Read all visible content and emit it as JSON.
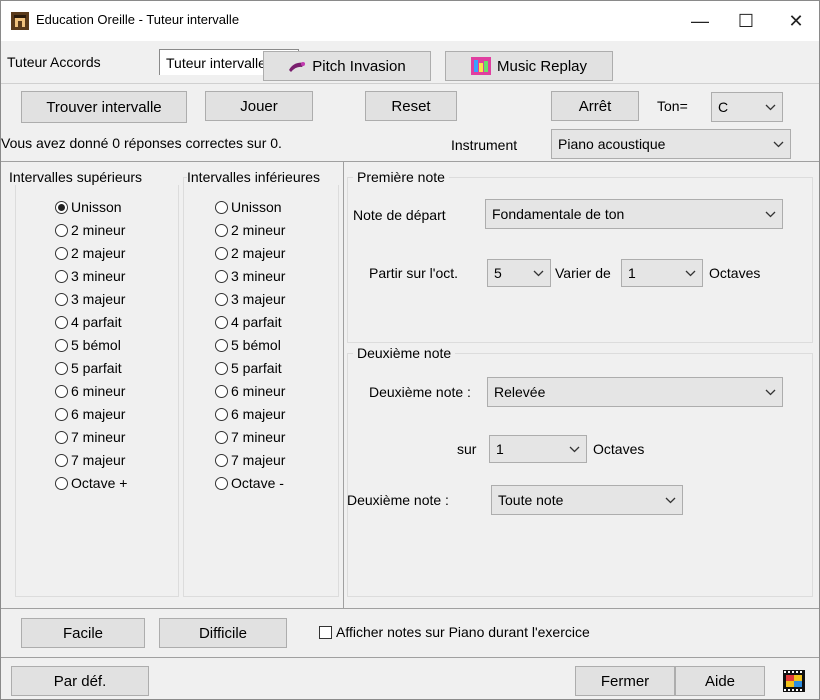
{
  "window": {
    "title": "Education Oreille - Tuteur intervalle",
    "controls": {
      "minimize": "—",
      "maximize": "☐",
      "close": "✕"
    }
  },
  "tabs": [
    {
      "label": "Tuteur Accords"
    },
    {
      "label": "Tuteur intervalle"
    }
  ],
  "tab_buttons": {
    "pitch_invasion": "Pitch Invasion",
    "music_replay": "Music Replay"
  },
  "toolbar": {
    "find_interval": "Trouver intervalle",
    "play": "Jouer",
    "reset": "Reset",
    "stop": "Arrêt",
    "key_label": "Ton=",
    "key_value": "C"
  },
  "status": "Vous avez donné 0 réponses correctes sur 0.",
  "instrument": {
    "label": "Instrument",
    "value": "Piano acoustique"
  },
  "upper_intervals": {
    "heading": "Intervalles supérieurs",
    "selected": "Unisson",
    "items": [
      "Unisson",
      "2 mineur",
      "2 majeur",
      "3 mineur",
      "3 majeur",
      "4 parfait",
      "5 bémol",
      "5 parfait",
      "6 mineur",
      "6 majeur",
      "7 mineur",
      "7 majeur",
      "Octave +"
    ]
  },
  "lower_intervals": {
    "heading": "Intervalles inférieures",
    "items": [
      "Unisson",
      "2 mineur",
      "2 majeur",
      "3 mineur",
      "3 majeur",
      "4 parfait",
      "5 bémol",
      "5 parfait",
      "6 mineur",
      "6 majeur",
      "7 mineur",
      "7 majeur",
      "Octave -"
    ]
  },
  "first_note": {
    "heading": "Première note",
    "start_label": "Note de départ",
    "start_value": "Fondamentale de ton",
    "octave_label": "Partir sur l'oct.",
    "octave_value": "5",
    "vary_label": "Varier de",
    "vary_value": "1",
    "octaves_label": "Octaves"
  },
  "second_note": {
    "heading": "Deuxième note",
    "direction_label": "Deuxième note :",
    "direction_value": "Relevée",
    "on_label": "sur",
    "on_value": "1",
    "octaves_label": "Octaves",
    "type_label": "Deuxième note :",
    "type_value": "Toute note"
  },
  "bottom": {
    "easy": "Facile",
    "hard": "Difficile",
    "show_notes_label": "Afficher notes sur Piano durant l'exercice",
    "show_notes_checked": false
  },
  "footer": {
    "defaults": "Par déf.",
    "close": "Fermer",
    "help": "Aide"
  }
}
